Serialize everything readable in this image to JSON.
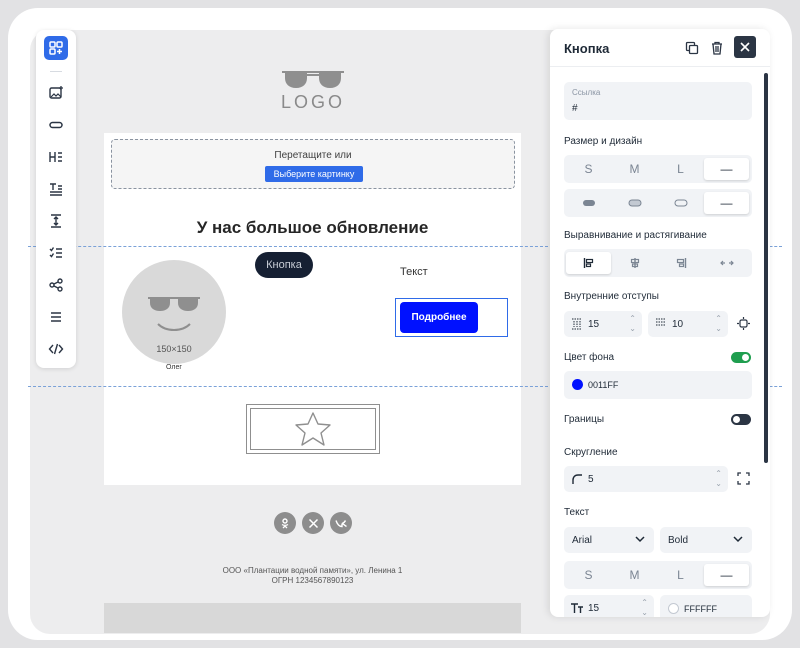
{
  "toolbar": {
    "tools": [
      {
        "name": "blocks-icon",
        "active": true
      },
      {
        "name": "image-add-icon"
      },
      {
        "name": "button-icon"
      },
      {
        "name": "heading-icon"
      },
      {
        "name": "text-icon"
      },
      {
        "name": "spacer-icon"
      },
      {
        "name": "list-icon"
      },
      {
        "name": "share-icon"
      },
      {
        "name": "menu-icon"
      },
      {
        "name": "code-icon"
      }
    ]
  },
  "email": {
    "logo_text": "LOGO",
    "drop_text": "Перетащите или",
    "drop_button": "Выберите картинку",
    "headline": "У нас большое обновление",
    "avatar_size": "150×150",
    "avatar_name": "Олег",
    "chip_label": "Кнопка",
    "text_block": "Текст",
    "cta_label": "Подробнее",
    "social": [
      "ok-icon",
      "x-icon",
      "vk-icon"
    ],
    "footer_line1": "ООО «Плантации водной памяти», ул. Ленина 1",
    "footer_line2": "ОГРН 1234567890123"
  },
  "panel": {
    "title": "Кнопка",
    "link_label": "Ссылка",
    "link_value": "#",
    "size_label": "Размер и дизайн",
    "sizes": [
      "S",
      "M",
      "L",
      "—"
    ],
    "selected_size": "—",
    "align_label": "Выравнивание и растягивание",
    "padding_label": "Внутренние отступы",
    "padding_vertical": "15",
    "padding_horizontal": "10",
    "bg_label": "Цвет фона",
    "bg_color": "0011FF",
    "bg_enabled": true,
    "border_label": "Границы",
    "border_enabled": false,
    "radius_label": "Скругление",
    "radius_value": "5",
    "text_label": "Текст",
    "font_family": "Arial",
    "font_weight": "Bold",
    "text_sizes": [
      "S",
      "M",
      "L",
      "—"
    ],
    "font_size": "15",
    "text_color": "FFFFFF"
  },
  "colors": {
    "accent": "#2f6be8",
    "cta": "#0011ff",
    "toggle_on": "#1f9e4f",
    "dark": "#2b3544"
  }
}
